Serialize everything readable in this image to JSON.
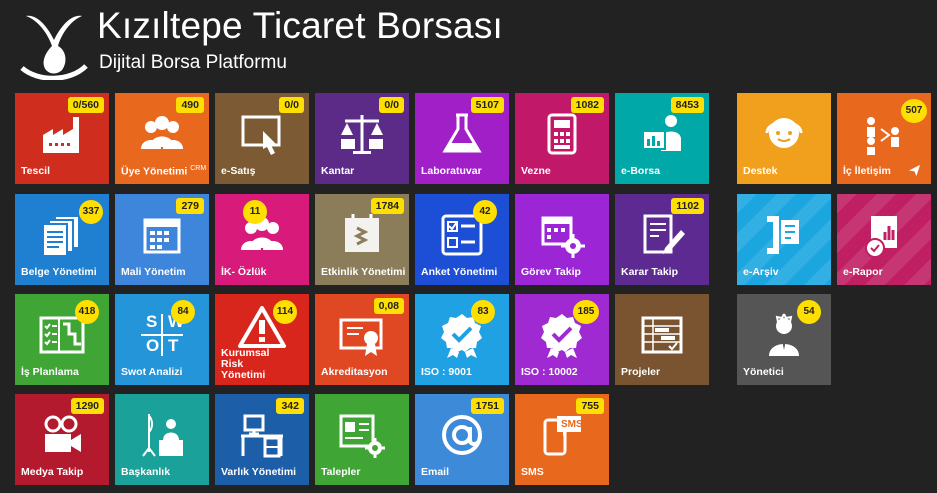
{
  "header": {
    "title": "Kızıltepe Ticaret Borsası",
    "subtitle": "Dijital Borsa Platformu"
  },
  "tiles": {
    "tescil": {
      "label": "Tescil",
      "badge": "0/560",
      "color": "#cf2e1f",
      "icon": "factory-icon"
    },
    "uye": {
      "label": "Üye Yönetimi",
      "sup": "CRM",
      "badge": "490",
      "color": "#e8681e",
      "icon": "users-icon"
    },
    "esatis": {
      "label": "e-Satış",
      "badge": "0/0",
      "color": "#7c5a34",
      "icon": "tablet-touch-icon"
    },
    "kantar": {
      "label": "Kantar",
      "badge": "0/0",
      "color": "#5b2b87",
      "icon": "scale-truck-icon"
    },
    "lab": {
      "label": "Laboratuvar",
      "badge": "5107",
      "color": "#a11fc7",
      "icon": "flask-icon"
    },
    "vezne": {
      "label": "Vezne",
      "badge": "1082",
      "color": "#c2186a",
      "icon": "calculator-icon"
    },
    "eborsa": {
      "label": "e-Borsa",
      "badge": "8453",
      "color": "#00a8a8",
      "icon": "presenter-icon"
    },
    "destek": {
      "label": "Destek",
      "color": "#f0a01c",
      "icon": "support-icon"
    },
    "iletisim": {
      "label": "İç İletişim",
      "badge": "507",
      "color": "#e8681e",
      "icon": "people-share-icon"
    },
    "belge": {
      "label": "Belge Yönetimi",
      "badge": "337",
      "color": "#1f7fd1",
      "icon": "documents-icon"
    },
    "mali": {
      "label": "Mali Yönetim",
      "badge": "279",
      "color": "#3e86dc",
      "icon": "calendar-icon"
    },
    "ik": {
      "label": "İK- Özlük",
      "badge": "11",
      "color": "#d81b7a",
      "icon": "team-icon"
    },
    "etkinlik": {
      "label": "Etkinlik Yönetimi",
      "badge": "1784",
      "color": "#8b7d5a",
      "icon": "event-calendar-icon"
    },
    "anket": {
      "label": "Anket Yönetimi",
      "badge": "42",
      "color": "#1d4fd6",
      "icon": "survey-icon"
    },
    "gorev": {
      "label": "Görev Takip",
      "color": "#9c26d6",
      "icon": "task-calendar-icon"
    },
    "karar": {
      "label": "Karar Takip",
      "badge": "1102",
      "color": "#5c2a91",
      "icon": "decision-pen-icon"
    },
    "earsiv": {
      "label": "e-Arşiv",
      "color": "#1ba6e0",
      "icon": "archive-clamp-icon"
    },
    "erapor": {
      "label": "e-Rapor",
      "color": "#c01f63",
      "icon": "report-icon"
    },
    "isplan": {
      "label": "İş Planlama",
      "badge": "418",
      "color": "#3fa535",
      "icon": "planning-icon"
    },
    "swot": {
      "label": "Swot Analizi",
      "badge": "84",
      "color": "#2595d9",
      "icon": "swot-icon",
      "letters": [
        "S",
        "W",
        "O",
        "T"
      ]
    },
    "risk": {
      "label": "Kurumsal Risk Yönetimi",
      "badge": "114",
      "color": "#d8261d",
      "icon": "warning-icon"
    },
    "akredit": {
      "label": "Akreditasyon",
      "badge": "0,08",
      "color": "#e04824",
      "icon": "certificate-icon"
    },
    "iso9001": {
      "label": "ISO : 9001",
      "badge": "83",
      "color": "#20a1e3",
      "icon": "badge-check-icon"
    },
    "iso10002": {
      "label": "ISO : 10002",
      "badge": "185",
      "color": "#9f2ad1",
      "icon": "badge-check-icon"
    },
    "projeler": {
      "label": "Projeler",
      "color": "#7a5430",
      "icon": "gantt-icon"
    },
    "yonetici": {
      "label": "Yönetici",
      "badge": "54",
      "color": "#555555",
      "icon": "manager-icon"
    },
    "medya": {
      "label": "Medya Takip",
      "badge": "1290",
      "color": "#b41a2e",
      "icon": "media-camera-icon"
    },
    "baskan": {
      "label": "Başkanlık",
      "color": "#1aa19a",
      "icon": "president-desk-icon"
    },
    "varlik": {
      "label": "Varlık Yönetimi",
      "badge": "342",
      "color": "#1d5ea8",
      "icon": "desk-computer-icon"
    },
    "talepler": {
      "label": "Talepler",
      "color": "#3fa535",
      "icon": "request-gear-icon"
    },
    "email": {
      "label": "Email",
      "badge": "1751",
      "color": "#3c8ad8",
      "icon": "at-icon"
    },
    "sms": {
      "label": "SMS",
      "badge": "755",
      "color": "#e8681e",
      "icon": "sms-phone-icon",
      "bubble": "SMS"
    }
  }
}
